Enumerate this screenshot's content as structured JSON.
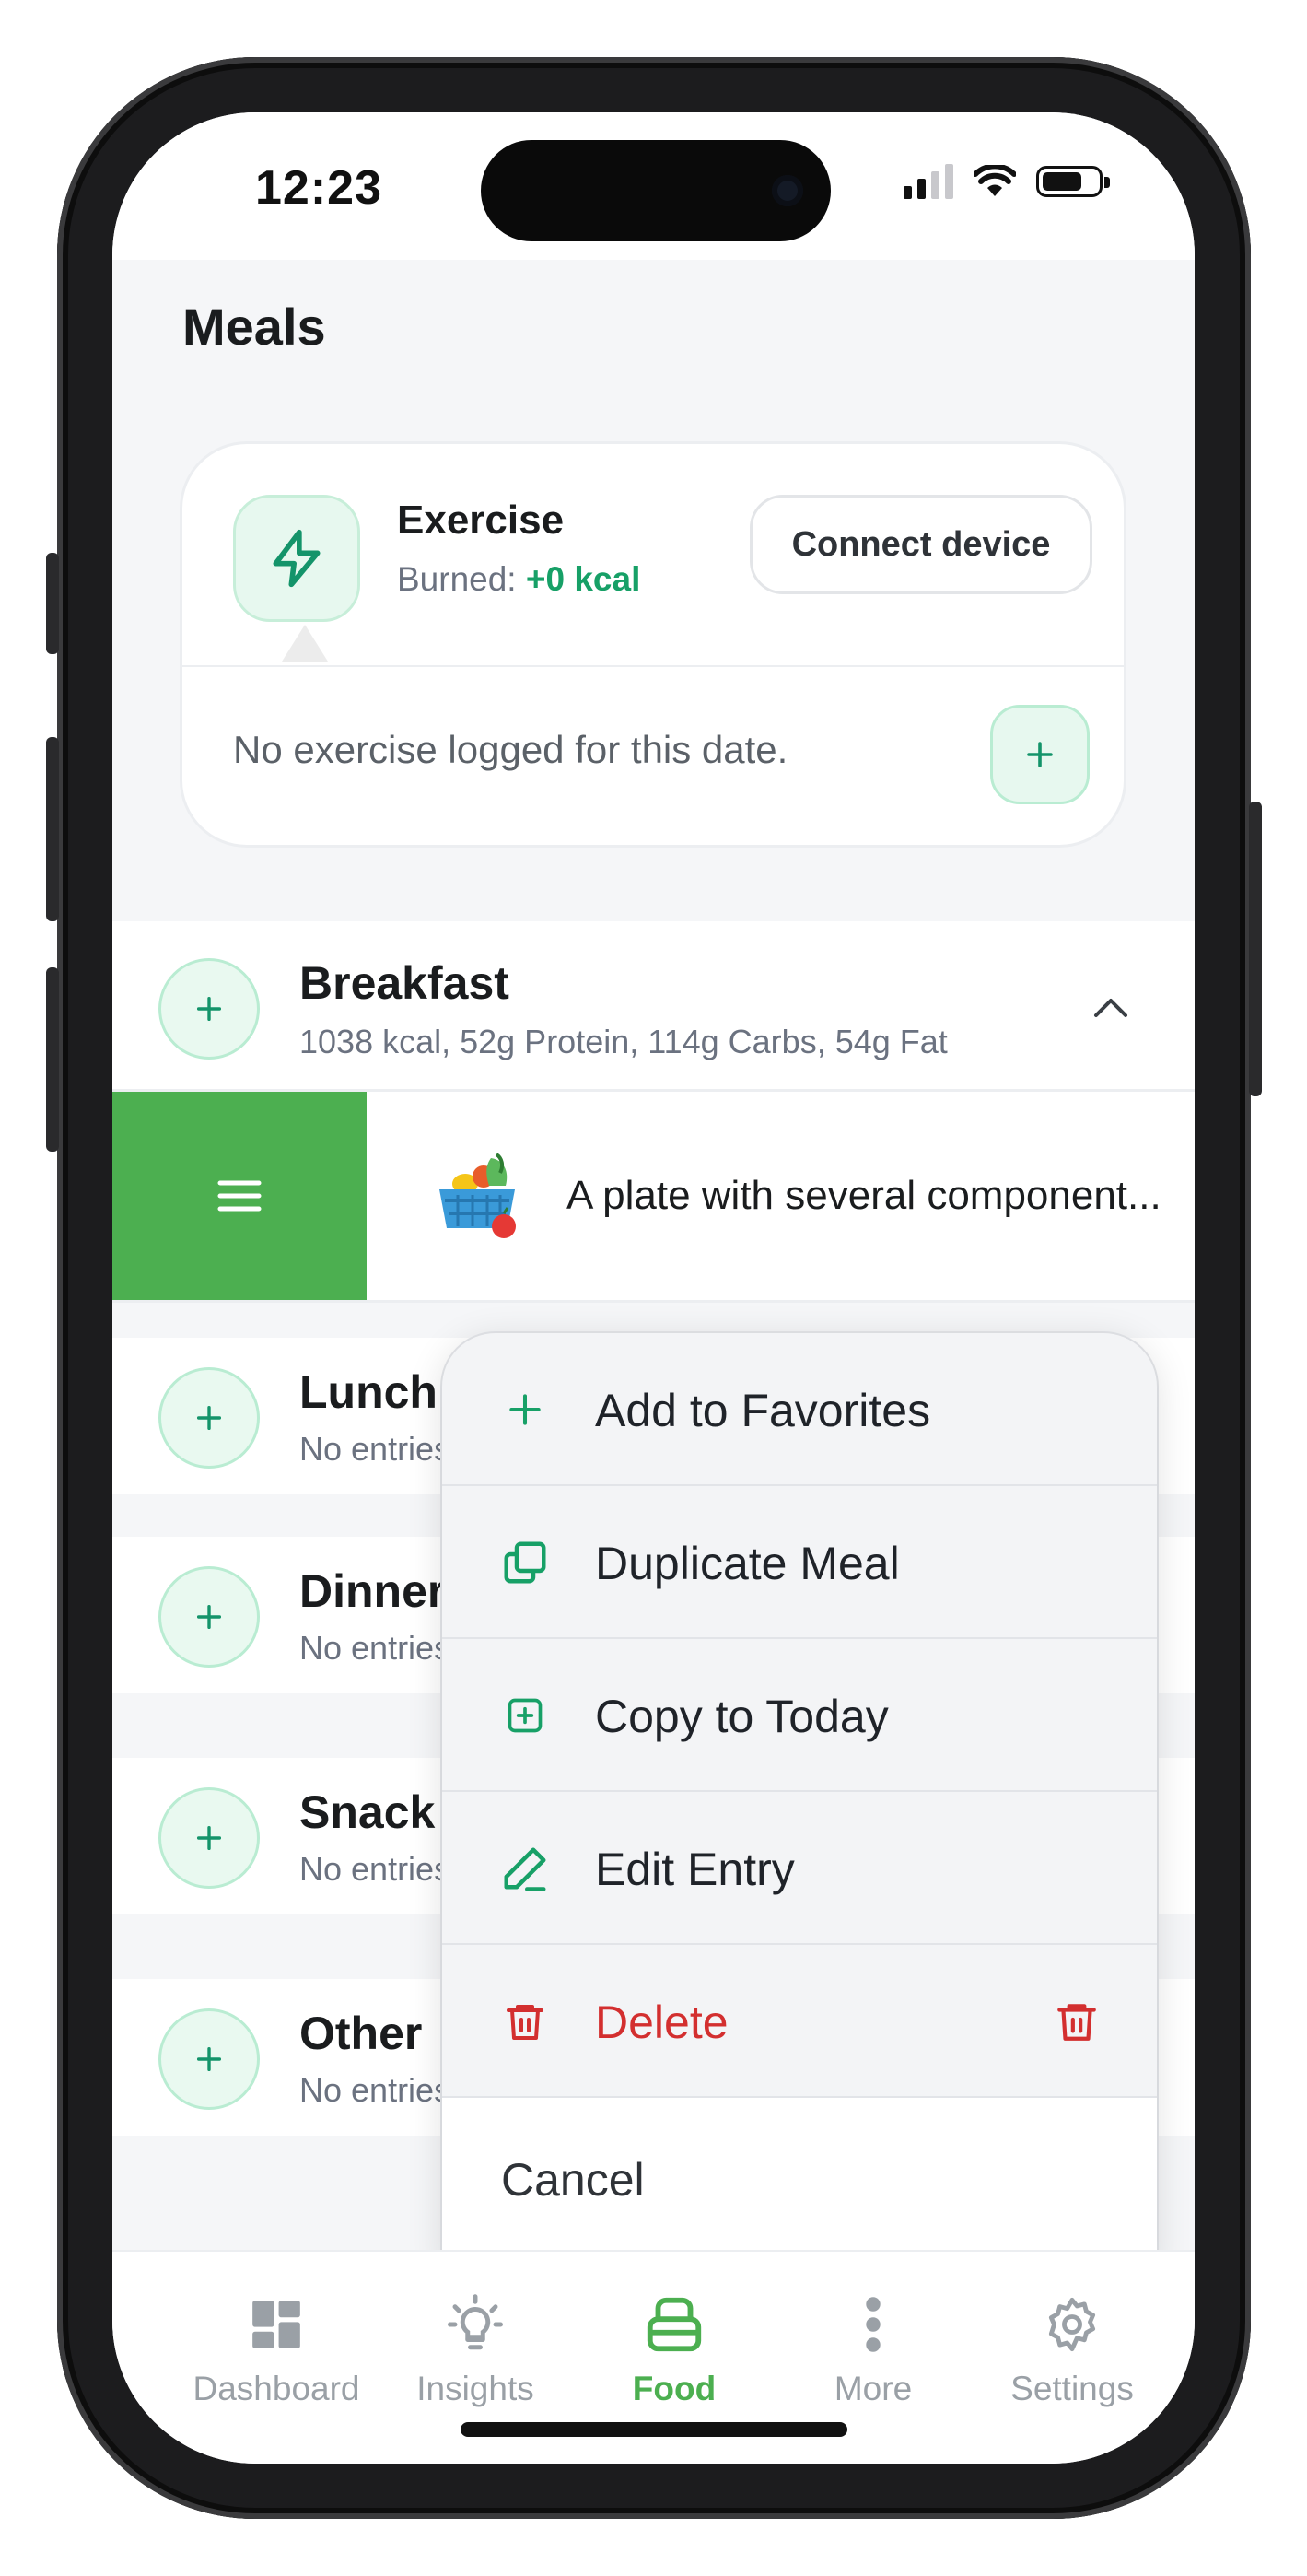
{
  "status": {
    "time": "12:23"
  },
  "page": {
    "title": "Meals"
  },
  "exercise": {
    "title": "Exercise",
    "burned_label": "Burned:",
    "burned_value": "+0 kcal",
    "connect_label": "Connect device",
    "empty_text": "No exercise logged for this date."
  },
  "meals": {
    "breakfast": {
      "title": "Breakfast",
      "summary": "1038 kcal, 52g Protein, 114g Carbs, 54g Fat"
    },
    "lunch": {
      "title": "Lunch",
      "summary": "No entries"
    },
    "dinner": {
      "title": "Dinner",
      "summary": "No entries"
    },
    "snack": {
      "title": "Snack",
      "summary": "No entries"
    },
    "other": {
      "title": "Other",
      "summary": "No entries"
    }
  },
  "entry": {
    "text": "A plate with several component..."
  },
  "menu": {
    "items": [
      {
        "label": "Add to Favorites",
        "icon": "plus-icon"
      },
      {
        "label": "Duplicate Meal",
        "icon": "duplicate-icon"
      },
      {
        "label": "Copy to Today",
        "icon": "copy-plus-icon"
      },
      {
        "label": "Edit Entry",
        "icon": "pencil-icon"
      },
      {
        "label": "Delete",
        "icon": "trash-icon"
      }
    ],
    "cancel": "Cancel"
  },
  "tabs": [
    {
      "label": "Dashboard",
      "icon": "dashboard-icon"
    },
    {
      "label": "Insights",
      "icon": "lightbulb-icon"
    },
    {
      "label": "Food",
      "icon": "food-icon",
      "active": true
    },
    {
      "label": "More",
      "icon": "more-icon"
    },
    {
      "label": "Settings",
      "icon": "gear-icon"
    }
  ],
  "colors": {
    "accent": "#4caf50",
    "accent_dark": "#17a067",
    "danger": "#d32f2f"
  }
}
